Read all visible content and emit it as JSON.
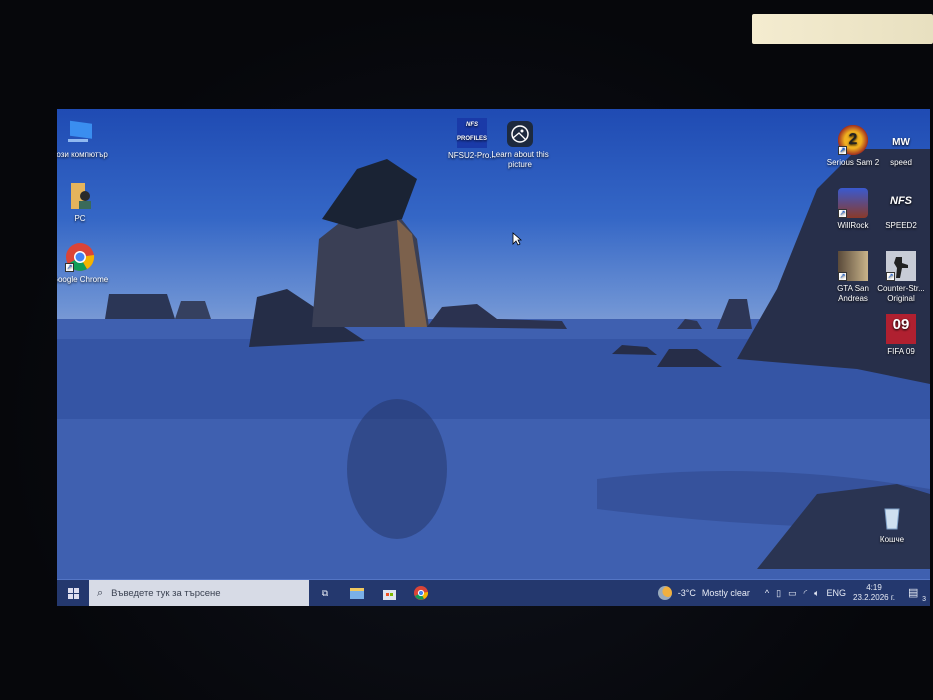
{
  "desktop": {
    "icons_left": [
      {
        "label": "Този компютър",
        "icon": "computer-icon"
      },
      {
        "label": "PC",
        "icon": "user-folder-icon"
      },
      {
        "label": "Google Chrome",
        "icon": "chrome-icon"
      }
    ],
    "icons_top": [
      {
        "label": "NFSU2-Pro...",
        "icon": "nfs-profiles-icon",
        "logo_text": "NFS PROFILES"
      },
      {
        "label": "Learn about this picture",
        "icon": "spotlight-icon"
      }
    ],
    "icons_right": [
      {
        "label": "Serious Sam 2",
        "icon": "serious-sam-icon"
      },
      {
        "label": "speed",
        "icon": "nfs-mw-icon",
        "logo_text": "MW"
      },
      {
        "label": "WillRock",
        "icon": "willrock-icon"
      },
      {
        "label": "SPEED2",
        "icon": "nfs-icon",
        "logo_text": "NFS"
      },
      {
        "label": "GTA San Andreas",
        "icon": "gta-icon"
      },
      {
        "label": "Counter-Str... Original",
        "icon": "counter-strike-icon"
      },
      {
        "label": "FIFA 09",
        "icon": "fifa-icon",
        "logo_text": "09"
      }
    ],
    "recycle_bin": {
      "label": "Кошче"
    }
  },
  "taskbar": {
    "search_placeholder": "Въведете тук за търсене",
    "pinned": [
      "task-view",
      "file-explorer",
      "store",
      "chrome"
    ],
    "weather": {
      "temp": "-3°C",
      "condition": "Mostly clear"
    },
    "language": "ENG",
    "time": "4:19",
    "date": "23.2.2026 г.",
    "notifications": "3"
  },
  "colors": {
    "taskbar": "#24386e",
    "search": "#d7dbe6"
  }
}
